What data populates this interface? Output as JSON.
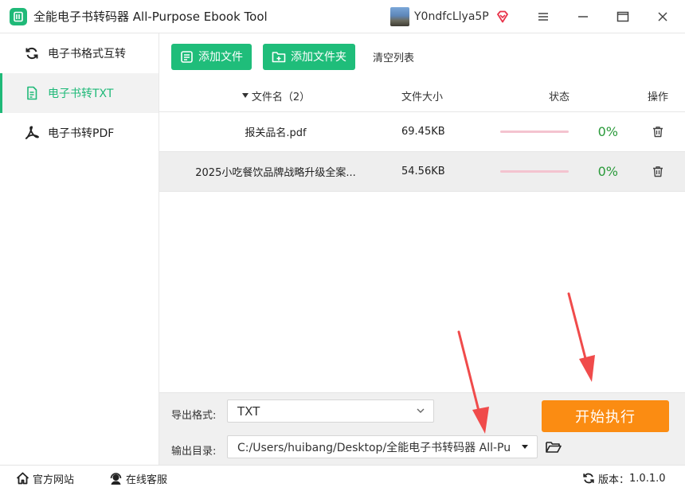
{
  "app": {
    "title": "全能电子书转码器 All-Purpose Ebook Tool",
    "username": "Y0ndfcLlya5P"
  },
  "sidebar": {
    "items": [
      {
        "label": "电子书格式互转",
        "icon": "refresh-icon",
        "active": false
      },
      {
        "label": "电子书转TXT",
        "icon": "document-icon",
        "active": true
      },
      {
        "label": "电子书转PDF",
        "icon": "pdf-icon",
        "active": false
      }
    ]
  },
  "toolbar": {
    "add_file": "添加文件",
    "add_folder": "添加文件夹",
    "clear_list": "清空列表"
  },
  "table": {
    "headers": {
      "name": "文件名（2）",
      "size": "文件大小",
      "status": "状态",
      "action": "操作"
    },
    "rows": [
      {
        "name": "报关品名.pdf",
        "size": "69.45KB",
        "progress": 0,
        "percent": "0%"
      },
      {
        "name": "2025小吃餐饮品牌战略升级全案...",
        "size": "54.56KB",
        "progress": 0,
        "percent": "0%"
      }
    ]
  },
  "settings": {
    "format_label": "导出格式:",
    "format_value": "TXT",
    "output_label": "输出目录:",
    "output_value": "C:/Users/huibang/Desktop/全能电子书转码器 All-Pu",
    "start_label": "开始执行"
  },
  "statusbar": {
    "website": "官方网站",
    "support": "在线客服",
    "version_label": "版本：",
    "version_value": "1.0.1.0"
  },
  "colors": {
    "accent": "#1fb978",
    "start": "#fb8c12",
    "progress_track": "#f4c3cf",
    "percent": "#2a9a3a",
    "arrow": "#f04b4b"
  }
}
